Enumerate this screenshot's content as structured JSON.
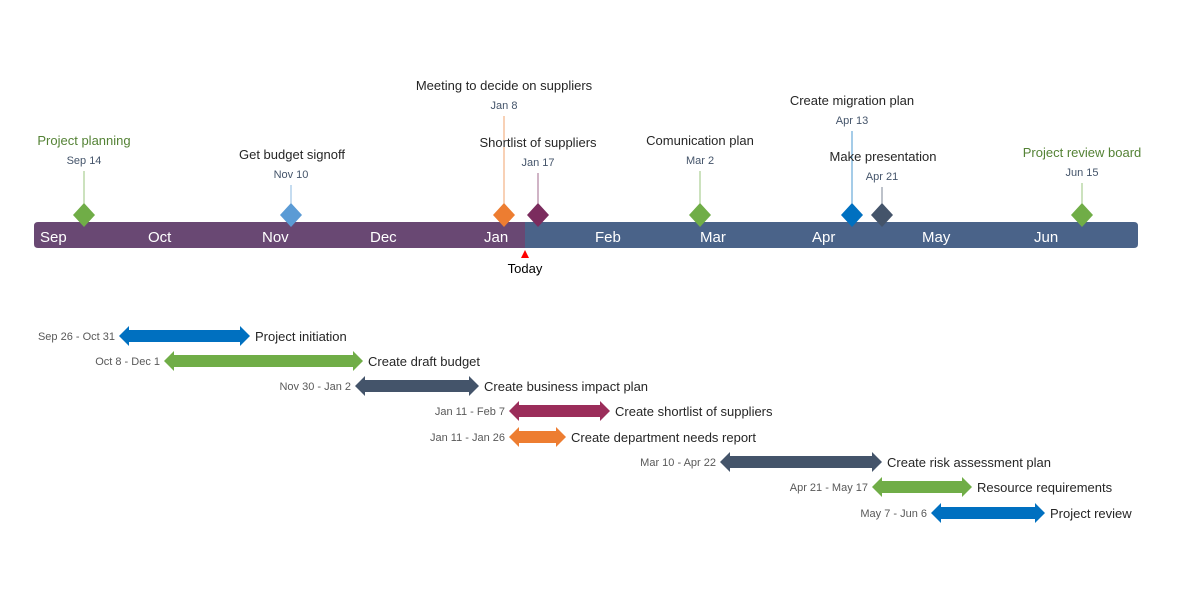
{
  "timeline": {
    "months": [
      "Sep",
      "Oct",
      "Nov",
      "Dec",
      "Jan",
      "Feb",
      "Mar",
      "Apr",
      "May",
      "Jun"
    ],
    "past_color": "#694873",
    "future_color": "#4a6389",
    "today_label": "Today",
    "today_marker_color": "#ff0000"
  },
  "milestones": [
    {
      "title": "Project planning",
      "date": "Sep 14",
      "color": "#70ad47",
      "title_color": "#548235"
    },
    {
      "title": "Get budget signoff",
      "date": "Nov 10",
      "color": "#5b9bd5",
      "title_color": "#262626"
    },
    {
      "title": "Meeting to decide on suppliers",
      "date": "Jan 8",
      "color": "#ed7d31",
      "title_color": "#262626"
    },
    {
      "title": "Shortlist of suppliers",
      "date": "Jan 17",
      "color": "#7b2c5e",
      "title_color": "#262626"
    },
    {
      "title": "Comunication plan",
      "date": "Mar 2",
      "color": "#70ad47",
      "title_color": "#262626"
    },
    {
      "title": "Create migration plan",
      "date": "Apr 13",
      "color": "#0070c0",
      "title_color": "#262626"
    },
    {
      "title": "Make presentation",
      "date": "Apr 21",
      "color": "#44546a",
      "title_color": "#262626"
    },
    {
      "title": "Project review board",
      "date": "Jun 15",
      "color": "#70ad47",
      "title_color": "#548235"
    }
  ],
  "tasks": [
    {
      "label": "Project initiation",
      "dates": "Sep 26 - Oct 31",
      "color": "#0070c0"
    },
    {
      "label": "Create draft budget",
      "dates": "Oct 8 - Dec 1",
      "color": "#70ad47"
    },
    {
      "label": "Create business impact plan",
      "dates": "Nov 30 - Jan 2",
      "color": "#44546a"
    },
    {
      "label": "Create shortlist of suppliers",
      "dates": "Jan 11 - Feb 7",
      "color": "#9b2d5a"
    },
    {
      "label": "Create department needs report",
      "dates": "Jan 11 - Jan 26",
      "color": "#ed7d31"
    },
    {
      "label": "Create risk assessment plan",
      "dates": "Mar 10 - Apr 22",
      "color": "#44546a"
    },
    {
      "label": "Resource requirements",
      "dates": "Apr 21 - May 17",
      "color": "#70ad47"
    },
    {
      "label": "Project review",
      "dates": "May 7 - Jun 6",
      "color": "#0070c0"
    }
  ]
}
